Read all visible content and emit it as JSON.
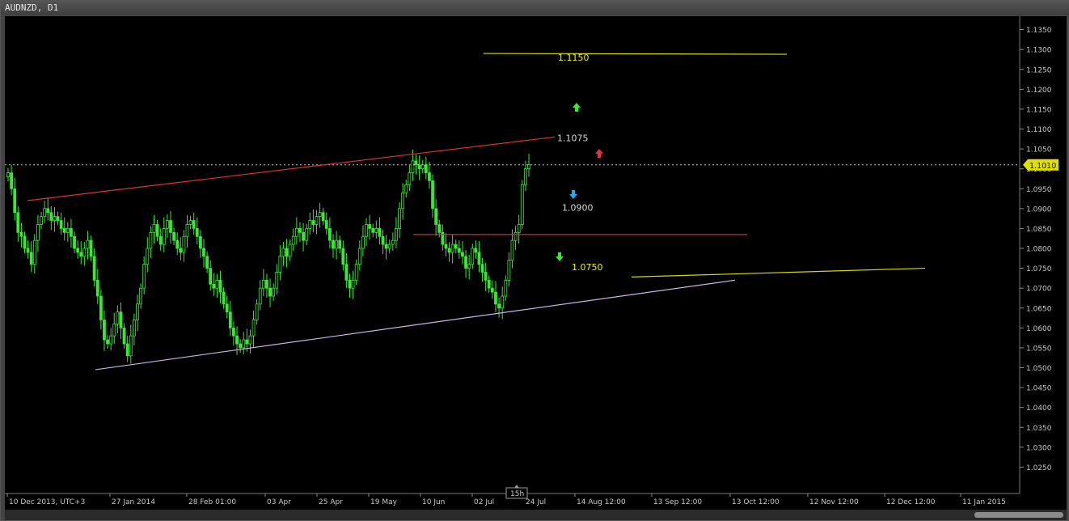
{
  "window": {
    "title": "AUDNZD, D1"
  },
  "colors": {
    "background": "#000000",
    "bull": "#39e833",
    "axis_text": "#c8c8c8",
    "resistance_line": "#e03030",
    "support_line": "#c8b4e8",
    "target_line": "#d8d800",
    "bid_badge": "#e0e000",
    "arrow_up": "#39e833",
    "arrow_down_blue": "#28a8e8",
    "arrow_up_red": "#e83030"
  },
  "chart_data": {
    "type": "candlestick",
    "symbol": "AUDNZD",
    "timeframe": "D1",
    "ylim": [
      1.02,
      1.14
    ],
    "y_ticks": [
      "1.1350",
      "1.1300",
      "1.1250",
      "1.1200",
      "1.1150",
      "1.1100",
      "1.1050",
      "1.1000",
      "1.0950",
      "1.0900",
      "1.0850",
      "1.0800",
      "1.0750",
      "1.0700",
      "1.0650",
      "1.0600",
      "1.0550",
      "1.0500",
      "1.0450",
      "1.0400",
      "1.0350",
      "1.0300",
      "1.0250"
    ],
    "x_ticks": [
      "10 Dec 2013, UTC+3",
      "27 Jan 2014",
      "28 Feb 01:00",
      "03 Apr",
      "25 Apr",
      "19 May",
      "10 Jun",
      "02 Jul",
      "24 Jul",
      "14 Aug 12:00",
      "13 Sep 12:00",
      "13 Oct 12:00",
      "12 Nov 12:00",
      "12 Dec 12:00",
      "11 Jan 2015"
    ],
    "current_price": "1.1010",
    "period_marker": "15h",
    "closes": [
      1.099,
      1.095,
      1.089,
      1.084,
      1.083,
      1.08,
      1.079,
      1.076,
      1.082,
      1.086,
      1.088,
      1.09,
      1.089,
      1.087,
      1.088,
      1.087,
      1.085,
      1.084,
      1.085,
      1.083,
      1.08,
      1.079,
      1.078,
      1.08,
      1.082,
      1.078,
      1.072,
      1.068,
      1.062,
      1.057,
      1.056,
      1.058,
      1.061,
      1.064,
      1.06,
      1.056,
      1.053,
      1.058,
      1.062,
      1.066,
      1.07,
      1.076,
      1.08,
      1.084,
      1.086,
      1.083,
      1.081,
      1.085,
      1.087,
      1.084,
      1.082,
      1.08,
      1.079,
      1.083,
      1.086,
      1.087,
      1.085,
      1.083,
      1.08,
      1.078,
      1.075,
      1.071,
      1.07,
      1.072,
      1.069,
      1.066,
      1.064,
      1.06,
      1.058,
      1.056,
      1.055,
      1.057,
      1.056,
      1.058,
      1.062,
      1.066,
      1.07,
      1.072,
      1.07,
      1.068,
      1.07,
      1.074,
      1.078,
      1.08,
      1.078,
      1.081,
      1.083,
      1.085,
      1.084,
      1.082,
      1.085,
      1.087,
      1.086,
      1.088,
      1.089,
      1.087,
      1.085,
      1.082,
      1.08,
      1.082,
      1.08,
      1.076,
      1.072,
      1.07,
      1.072,
      1.076,
      1.08,
      1.083,
      1.086,
      1.085,
      1.084,
      1.085,
      1.083,
      1.081,
      1.08,
      1.081,
      1.082,
      1.085,
      1.09,
      1.094,
      1.096,
      1.099,
      1.102,
      1.101,
      1.1,
      1.101,
      1.099,
      1.097,
      1.09,
      1.086,
      1.084,
      1.081,
      1.08,
      1.079,
      1.081,
      1.08,
      1.079,
      1.078,
      1.075,
      1.076,
      1.08,
      1.079,
      1.076,
      1.074,
      1.072,
      1.07,
      1.069,
      1.066,
      1.065,
      1.068,
      1.072,
      1.077,
      1.082,
      1.084,
      1.086,
      1.096,
      1.1,
      1.101
    ]
  },
  "annotations": {
    "level_1150": "1.1150",
    "level_1075": "1.1075",
    "level_0900": "1.0900",
    "level_0750": "1.0750"
  },
  "trendlines": {
    "resistance": {
      "from": [
        "10 Dec 2013",
        1.092
      ],
      "to": [
        "24 Jul",
        1.108
      ]
    },
    "support": {
      "from": [
        "27 Jan 2014",
        1.0495
      ],
      "to": [
        "13 Oct",
        1.072
      ]
    },
    "target_1150": {
      "from": [
        "24 Jul",
        1.129
      ],
      "to": [
        "12 Nov",
        1.1288
      ]
    },
    "level_0900_line": {
      "from": [
        "10 Jun",
        1.0835
      ],
      "to": [
        "13 Oct",
        1.0835
      ]
    },
    "target_0750": {
      "from": [
        "14 Aug",
        1.0728
      ],
      "to": [
        "12 Dec",
        1.075
      ]
    }
  }
}
